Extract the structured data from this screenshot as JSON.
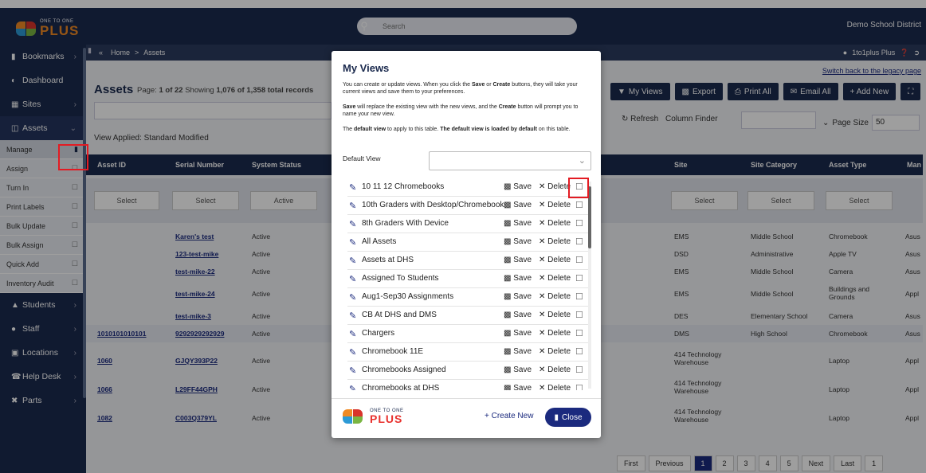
{
  "header": {
    "logo_small": "ONE TO ONE",
    "logo_big": "PLUS",
    "search_placeholder": "Search",
    "district": "Demo School District"
  },
  "breadcrumb": {
    "home": "Home",
    "sep": ">",
    "current": "Assets"
  },
  "user": {
    "name": "1to1plus Plus"
  },
  "legacy_link": "Switch back to the legacy page",
  "sidebar": {
    "items": [
      {
        "label": "Bookmarks"
      },
      {
        "label": "Dashboard"
      },
      {
        "label": "Sites"
      },
      {
        "label": "Assets"
      }
    ],
    "sub_items": [
      "Manage",
      "Assign",
      "Turn In",
      "Print Labels",
      "Bulk Update",
      "Bulk Assign",
      "Quick Add",
      "Inventory Audit"
    ],
    "bottom_items": [
      {
        "label": "Students"
      },
      {
        "label": "Staff"
      },
      {
        "label": "Locations"
      },
      {
        "label": "Help Desk"
      },
      {
        "label": "Parts"
      }
    ]
  },
  "page": {
    "title": "Assets",
    "page_label": "Page:",
    "page_info": "1 of 22",
    "showing_label": "Showing",
    "showing_info": "1,076 of 1,358 total records",
    "view_applied": "View Applied: Standard Modified"
  },
  "toolbar": {
    "my_views": "My Views",
    "export": "Export",
    "print_all": "Print All",
    "email_all": "Email All",
    "add_new": "+ Add New"
  },
  "refresh": "Refresh",
  "column_finder": "Column Finder",
  "page_size_label": "Page Size",
  "page_size_value": "50",
  "table": {
    "headers": [
      "Asset ID",
      "Serial Number",
      "System Status",
      "Site",
      "Site Category",
      "Asset Type",
      "Man"
    ],
    "filter_select": "Select",
    "filter_active": "Active",
    "rows": [
      {
        "asset_id": "",
        "serial": "Karen's test",
        "status": "Active",
        "site": "EMS",
        "category": "Middle School",
        "type": "Chromebook",
        "man": "Asus"
      },
      {
        "asset_id": "",
        "serial": "123-test-mike",
        "status": "Active",
        "site": "DSD",
        "category": "Administrative",
        "type": "Apple TV",
        "man": "Asus"
      },
      {
        "asset_id": "",
        "serial": "test-mike-22",
        "status": "Active",
        "site": "EMS",
        "category": "Middle School",
        "type": "Camera",
        "man": "Asus"
      },
      {
        "asset_id": "",
        "serial": "test-mike-24",
        "status": "Active",
        "site": "EMS",
        "category": "Middle School",
        "type": "Buildings and Grounds",
        "man": "Appl"
      },
      {
        "asset_id": "",
        "serial": "test-mike-3",
        "status": "Active",
        "site": "DES",
        "category": "Elementary School",
        "type": "Camera",
        "man": "Asus"
      },
      {
        "asset_id": "1010101010101",
        "serial": "9292929292929",
        "status": "Active",
        "site": "DMS",
        "category": "High School",
        "type": "Chromebook",
        "man": "Asus"
      },
      {
        "asset_id": "1060",
        "serial": "GJQY393P22",
        "status": "Active",
        "site": "414 Technology Warehouse",
        "category": "",
        "type": "Laptop",
        "man": "Appl"
      },
      {
        "asset_id": "1066",
        "serial": "L29FF44GPH",
        "status": "Active",
        "site": "414 Technology Warehouse",
        "category": "",
        "type": "Laptop",
        "man": "Appl"
      },
      {
        "asset_id": "1082",
        "serial": "C003Q379YL",
        "status": "Active",
        "site": "414 Technology Warehouse",
        "category": "",
        "type": "Laptop",
        "man": "Appl"
      }
    ]
  },
  "modal": {
    "title": "My Views",
    "text1_a": "You can create or update views. When you click the ",
    "text1_save": "Save",
    "text1_or": " or ",
    "text1_create": "Create",
    "text1_b": " buttons, they will take your current views and save them to your preferences.",
    "text2_save": "Save",
    "text2_a": " will replace the existing view with the new views, and the ",
    "text2_create": "Create",
    "text2_b": " button will prompt you to name your new view.",
    "text3_a": "The ",
    "text3_dv": "default view",
    "text3_b": " to apply to this table. ",
    "text3_c": "The default view is loaded by default",
    "text3_d": " on this table.",
    "default_view_label": "Default View",
    "save_label": "Save",
    "delete_label": "Delete",
    "views": [
      "10 11 12 Chromebooks",
      "10th Graders with Desktop/Chromebooks",
      "8th Graders With Device",
      "All Assets",
      "Assets at DHS",
      "Assigned To Students",
      "Aug1-Sep30 Assignments",
      "CB At DHS and DMS",
      "Chargers",
      "Chromebook 11E",
      "Chromebooks Assigned",
      "Chromebooks at DHS"
    ],
    "create_new": "+ Create New",
    "close": "Close"
  },
  "pager": [
    "First",
    "Previous",
    "1",
    "2",
    "3",
    "4",
    "5",
    "Next",
    "Last",
    "1"
  ]
}
